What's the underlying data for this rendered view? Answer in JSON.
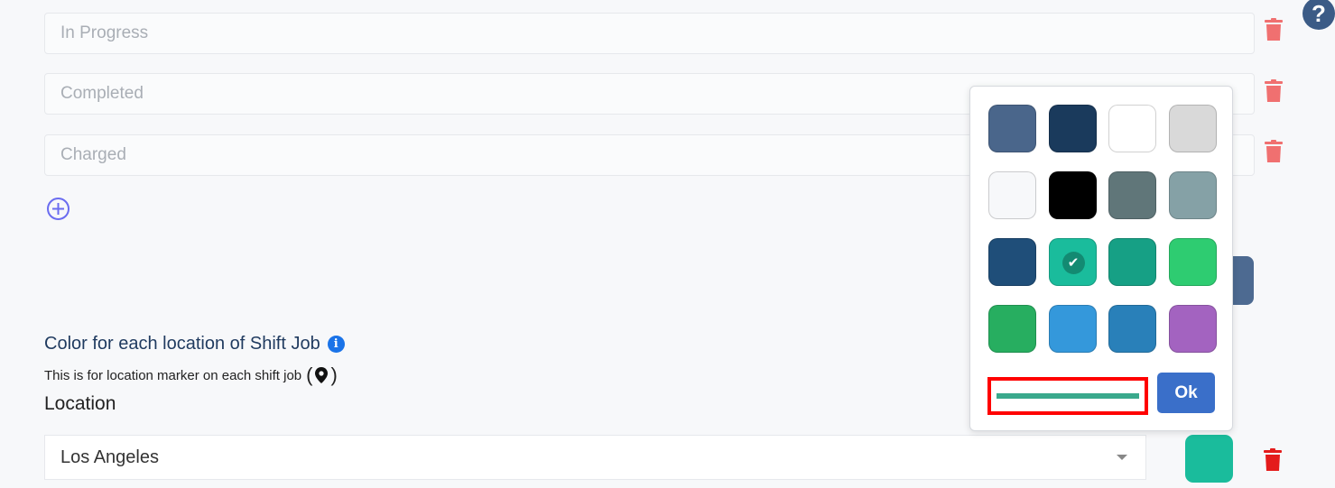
{
  "statuses": [
    {
      "placeholder": "In Progress"
    },
    {
      "placeholder": "Completed"
    },
    {
      "placeholder": "Charged"
    }
  ],
  "icons": {
    "trash": "trash-icon",
    "add": "plus-circle-icon",
    "help": "question-icon",
    "info": "info-icon",
    "marker": "map-marker-icon",
    "check": "check-icon"
  },
  "help_label": "?",
  "section": {
    "title": "Color for each location of Shift Job",
    "info_label": "i",
    "description": "This is for location marker on each shift job",
    "paren_open": "(",
    "paren_close": ")",
    "location_label": "Location"
  },
  "location": {
    "selected": "Los Angeles",
    "color": "#1abc9c"
  },
  "color_picker": {
    "colors": [
      "#4a668b",
      "#1a3a5c",
      "#ffffff",
      "#d9d9d9",
      "#f7f8fa",
      "#000000",
      "#607679",
      "#85a1a6",
      "#1f4e79",
      "#1abc9c",
      "#16a085",
      "#2ecc71",
      "#27ae60",
      "#3498db",
      "#2980b9",
      "#a363c0"
    ],
    "selected": "#1abc9c",
    "check_glyph": "✔",
    "ok_label": "Ok"
  },
  "theme": {
    "danger": "#f07070",
    "danger_strong": "#e41b1b",
    "accent": "#3a6fc9"
  }
}
